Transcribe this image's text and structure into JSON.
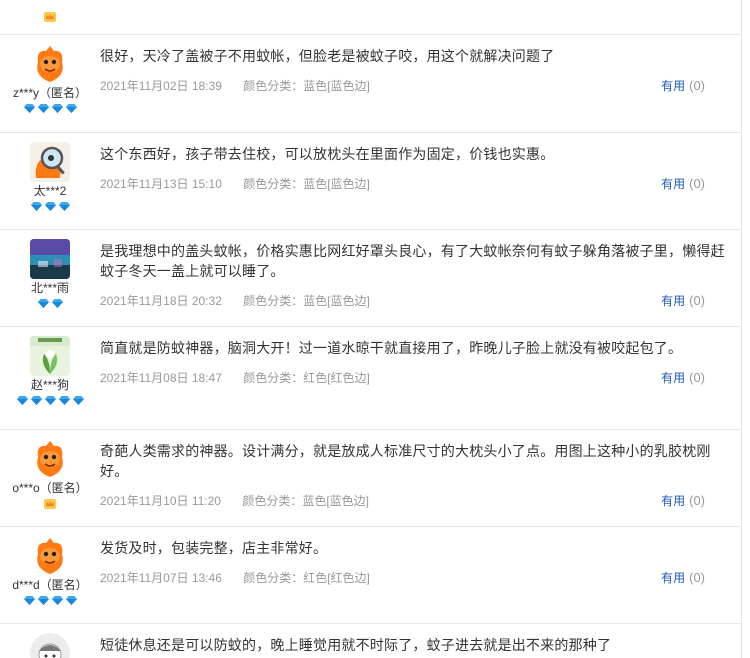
{
  "reviews_top": {
    "level_icon": "crown-icon"
  },
  "reviews": [
    {
      "username": "z***y（匿名）",
      "avatar": "mascot-avatar",
      "gems": 4,
      "text": "很好，天冷了盖被子不用蚊帐，但脸老是被蚊子咬，用这个就解决问题了",
      "date": "2021年11月02日 18:39",
      "attr": "颜色分类：蓝色[蓝色边]",
      "useful_label": "有用",
      "useful_count": "(0)"
    },
    {
      "username": "太***2",
      "avatar": "magnifier-mascot-avatar",
      "gems": 3,
      "text": "这个东西好，孩子带去住校，可以放枕头在里面作为固定，价钱也实惠。",
      "date": "2021年11月13日 15:10",
      "attr": "颜色分类：蓝色[蓝色边]",
      "useful_label": "有用",
      "useful_count": "(0)"
    },
    {
      "username": "北***雨",
      "avatar": "photo-avatar",
      "gems": 2,
      "text": "是我理想中的盖头蚊帐，价格实惠比网红好罩头良心，有了大蚊帐奈何有蚊子躲角落被子里，懒得赶蚊子冬天一盖上就可以睡了。",
      "date": "2021年11月18日 20:32",
      "attr": "颜色分类：蓝色[蓝色边]",
      "useful_label": "有用",
      "useful_count": "(0)"
    },
    {
      "username": "赵***狗",
      "avatar": "plant-photo-avatar",
      "gems": 5,
      "text": "简直就是防蚊神器，脑洞大开！过一道水晾干就直接用了，昨晚儿子脸上就没有被咬起包了。",
      "date": "2021年11月08日 18:47",
      "attr": "颜色分类：红色[红色边]",
      "useful_label": "有用",
      "useful_count": "(0)"
    },
    {
      "username": "o***o（匿名）",
      "avatar": "mascot-avatar",
      "gems": 0,
      "crown": true,
      "text": "奇葩人类需求的神器。设计满分，就是放成人标准尺寸的大枕头小了点。用图上这种小的乳胶枕刚好。",
      "date": "2021年11月10日 11:20",
      "attr": "颜色分类：蓝色[蓝色边]",
      "useful_label": "有用",
      "useful_count": "(0)"
    },
    {
      "username": "d***d（匿名）",
      "avatar": "mascot-avatar",
      "gems": 4,
      "text": "发货及时，包装完整，店主非常好。",
      "date": "2021年11月07日 13:46",
      "attr": "颜色分类：红色[红色边]",
      "useful_label": "有用",
      "useful_count": "(0)"
    },
    {
      "username": "",
      "avatar": "cartoon-round-avatar",
      "gems": 0,
      "text": "短徒休息还是可以防蚊的，晚上睡觉用就不时际了，蚊子进去就是出不来的那种了",
      "date": "",
      "attr": "",
      "useful_label": "",
      "useful_count": ""
    }
  ]
}
